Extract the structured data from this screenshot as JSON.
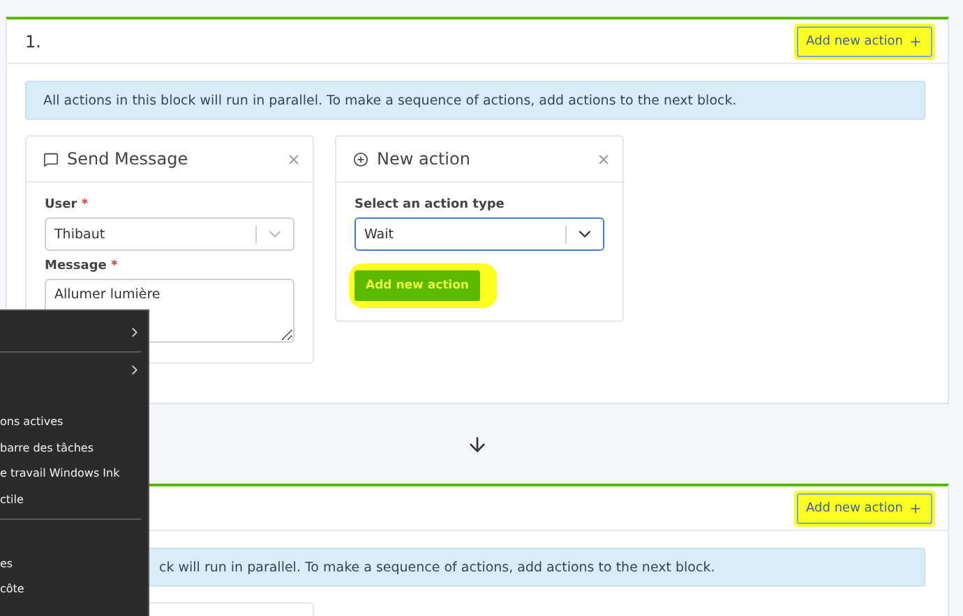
{
  "blocks": [
    {
      "number": "1.",
      "add_button": {
        "label": "Add new action",
        "highlighted": true
      },
      "info": "All actions in this block will run in parallel. To make a sequence of actions, add actions to the next block.",
      "cards": [
        {
          "kind": "message",
          "title": "Send Message",
          "fields": [
            {
              "kind": "select",
              "label": "User",
              "required_mark": "*",
              "value": "Thibaut",
              "focused": false
            },
            {
              "kind": "textarea",
              "label": "Message",
              "required_mark": "*",
              "value": "Allumer lumière"
            }
          ]
        },
        {
          "kind": "new_action",
          "title": "New action",
          "fields": [
            {
              "kind": "select",
              "label": "Select an action type",
              "value": "Wait",
              "focused": true
            }
          ],
          "button": {
            "label": "Add new action",
            "highlighted": true
          }
        }
      ]
    },
    {
      "add_button": {
        "label": "Add new action",
        "highlighted": true
      },
      "info": "ck will run in parallel. To make a sequence of actions, add actions to the next block.",
      "cards": [
        {
          "kind": "blank"
        }
      ]
    }
  ],
  "context_menu": {
    "items": [
      {
        "kind": "submenu"
      },
      {
        "kind": "separator"
      },
      {
        "kind": "submenu"
      },
      {
        "kind": "item"
      },
      {
        "kind": "item",
        "label": "ons actives"
      },
      {
        "kind": "item",
        "label": "barre des tâches"
      },
      {
        "kind": "item",
        "label": "e travail Windows Ink"
      },
      {
        "kind": "item",
        "label": "ctile"
      },
      {
        "kind": "separator"
      },
      {
        "kind": "item"
      },
      {
        "kind": "item",
        "label": "es"
      },
      {
        "kind": "item",
        "label": "côte"
      }
    ]
  }
}
